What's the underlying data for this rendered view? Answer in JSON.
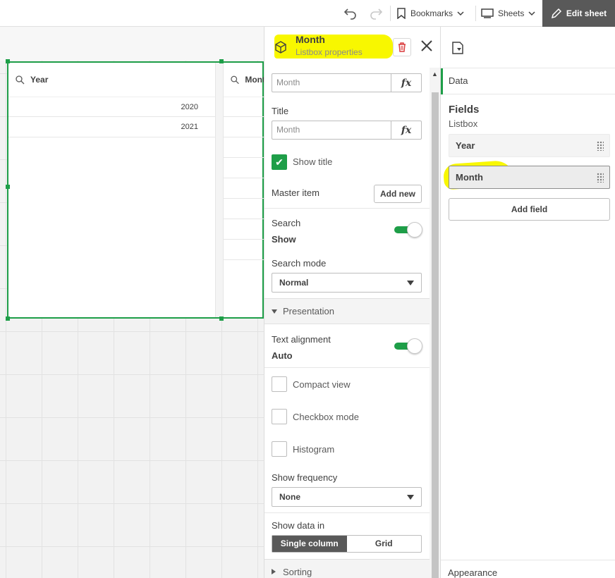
{
  "toolbar": {
    "bookmarks_label": "Bookmarks",
    "sheets_label": "Sheets",
    "edit_sheet_label": "Edit sheet"
  },
  "canvas": {
    "listbox_year": {
      "header": "Year",
      "values": [
        "2020",
        "2021"
      ]
    },
    "listbox_month": {
      "header": "Mont"
    }
  },
  "properties": {
    "title": "Month",
    "subtitle": "Listbox properties",
    "field_value": "Month",
    "title_label": "Title",
    "title_value": "Month",
    "show_title_label": "Show title",
    "show_title_checked": true,
    "master_item_label": "Master item",
    "add_new_label": "Add new",
    "search_label": "Search",
    "search_value": "Show",
    "search_mode_label": "Search mode",
    "search_mode_value": "Normal",
    "presentation_label": "Presentation",
    "text_alignment_label": "Text alignment",
    "text_alignment_value": "Auto",
    "compact_view_label": "Compact view",
    "checkbox_mode_label": "Checkbox mode",
    "histogram_label": "Histogram",
    "show_frequency_label": "Show frequency",
    "show_frequency_value": "None",
    "show_data_in_label": "Show data in",
    "show_data_options": [
      "Single column",
      "Grid"
    ],
    "show_data_selected": "Single column",
    "sorting_label": "Sorting",
    "fx_symbol": "fx"
  },
  "data_panel": {
    "tab_label": "Data",
    "fields_title": "Fields",
    "fields_subtitle": "Listbox",
    "fields": [
      "Year",
      "Month"
    ],
    "selected_field": "Month",
    "add_field_label": "Add field",
    "appearance_label": "Appearance"
  },
  "colors": {
    "accent_green": "#1e9e48",
    "highlight_yellow": "#f8f700",
    "edit_button_bg": "#595959",
    "delete_red": "#d9383a"
  }
}
